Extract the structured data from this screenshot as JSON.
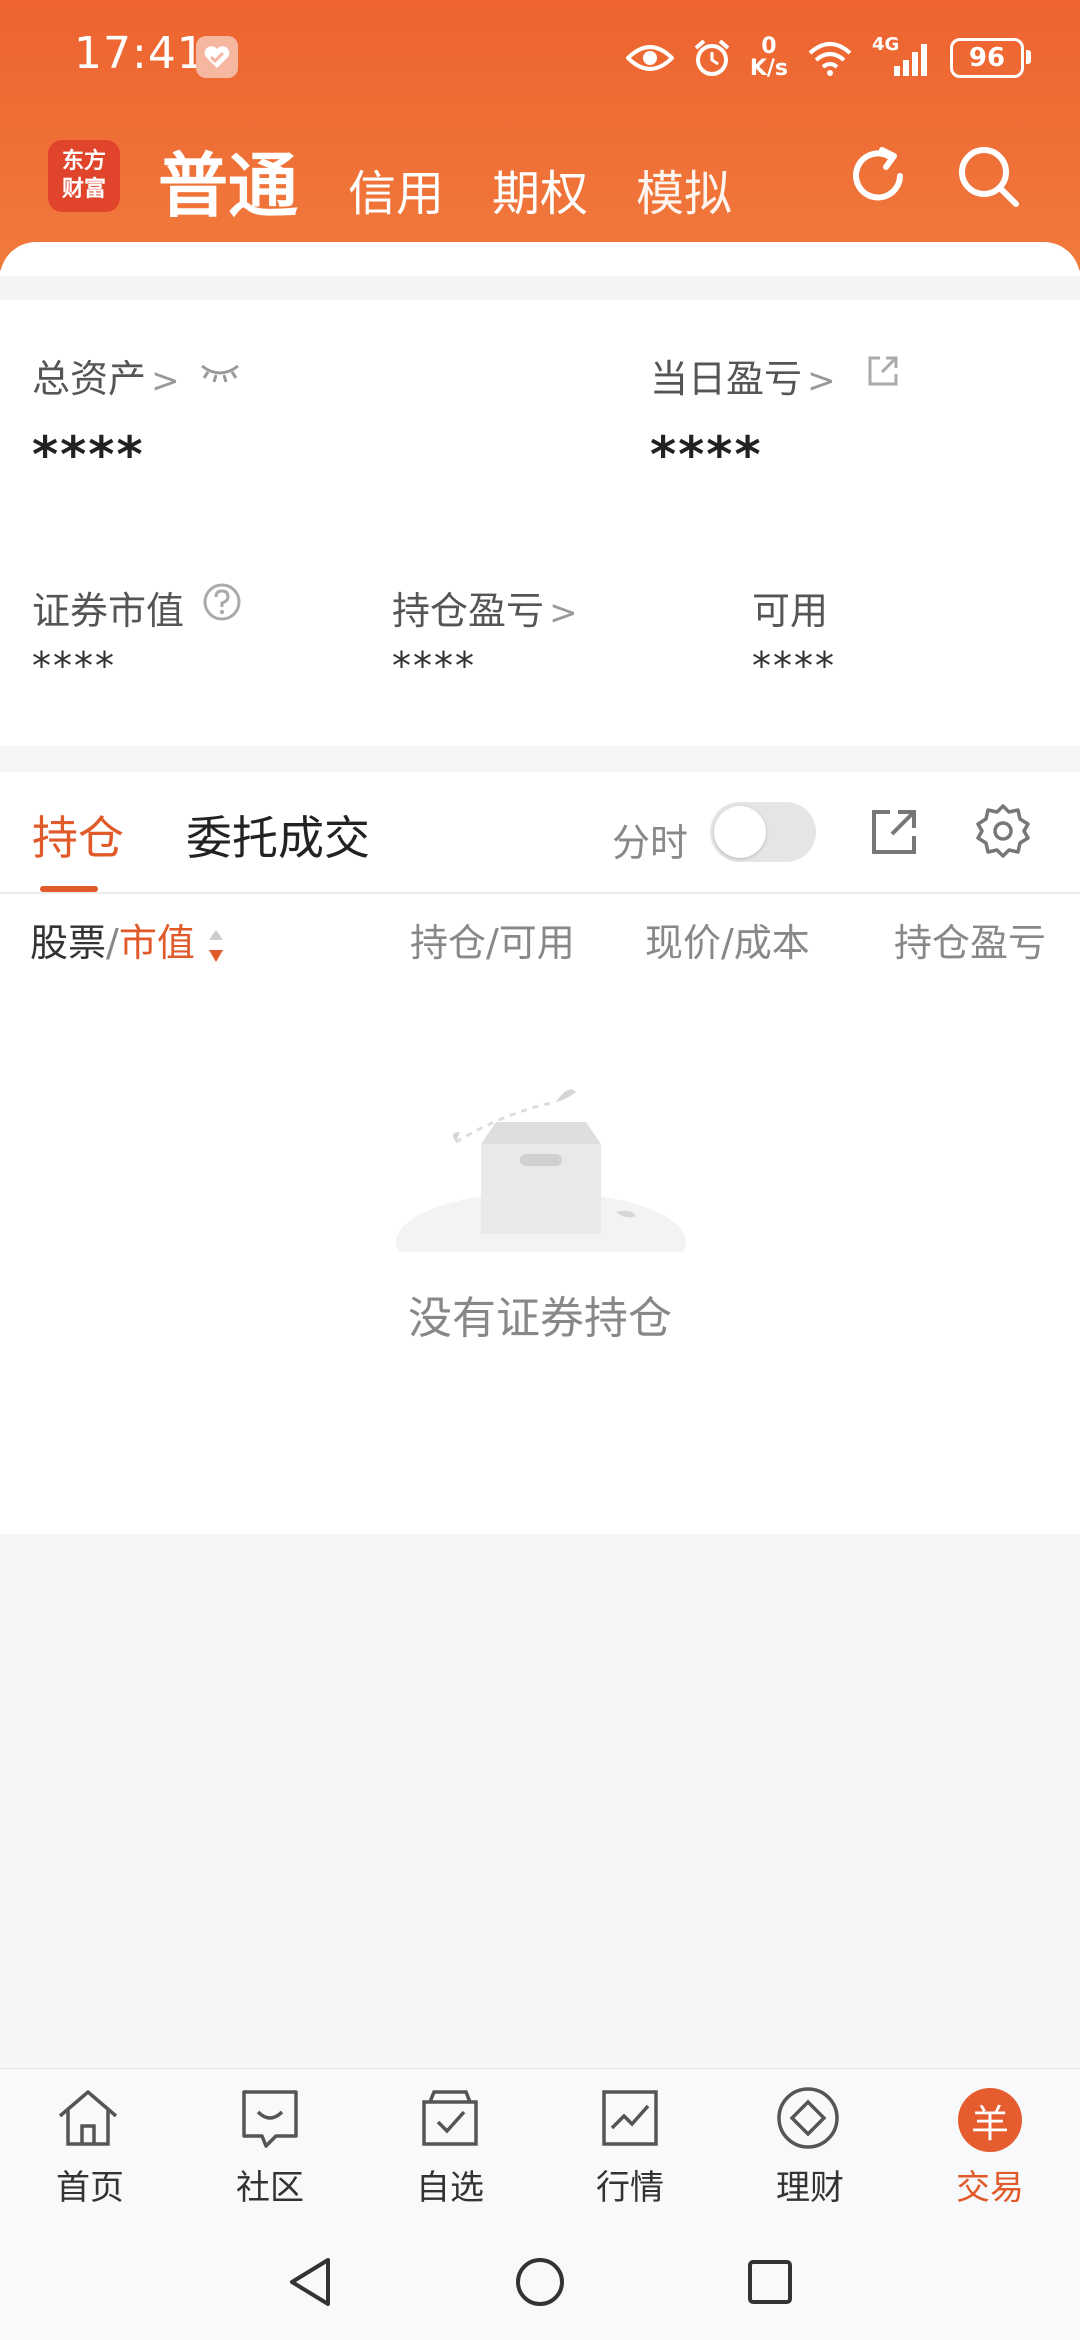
{
  "status_bar": {
    "time": "17:41",
    "net_speed_value": "0",
    "net_speed_unit": "K/s",
    "network_type": "4G",
    "battery": "96",
    "icons": [
      "health-app-icon",
      "eye-icon",
      "alarm-icon",
      "wifi-icon",
      "signal-icon",
      "battery-icon"
    ]
  },
  "header": {
    "logo_line1": "东方",
    "logo_line2": "财富",
    "tabs": [
      {
        "label": "普通",
        "active": true
      },
      {
        "label": "信用",
        "active": false
      },
      {
        "label": "期权",
        "active": false
      },
      {
        "label": "模拟",
        "active": false
      }
    ],
    "accent": "#ee6330"
  },
  "assets": {
    "total_assets_label": "总资产",
    "total_assets_value": "****",
    "daily_pnl_label": "当日盈亏",
    "daily_pnl_value": "****",
    "market_value_label": "证券市值",
    "market_value_value": "****",
    "position_pnl_label": "持仓盈亏",
    "position_pnl_value": "****",
    "available_label": "可用",
    "available_value": "****"
  },
  "positions": {
    "tab_active": "持仓",
    "tab_inactive": "委托成交",
    "toggle_label": "分时",
    "toggle_on": false,
    "col_stock": "股票",
    "col_sep": "/",
    "col_market_value": "市值",
    "col_holding": "持仓/可用",
    "col_price": "现价/成本",
    "col_pnl": "持仓盈亏",
    "empty_text": "没有证券持仓"
  },
  "bottom_nav": {
    "items": [
      {
        "label": "首页",
        "icon": "home-icon",
        "active": false
      },
      {
        "label": "社区",
        "icon": "community-icon",
        "active": false
      },
      {
        "label": "自选",
        "icon": "watchlist-icon",
        "active": false
      },
      {
        "label": "行情",
        "icon": "market-icon",
        "active": false
      },
      {
        "label": "理财",
        "icon": "wealth-icon",
        "active": false
      },
      {
        "label": "交易",
        "icon": "trade-icon",
        "active": true
      }
    ],
    "trade_glyph": "羊"
  }
}
